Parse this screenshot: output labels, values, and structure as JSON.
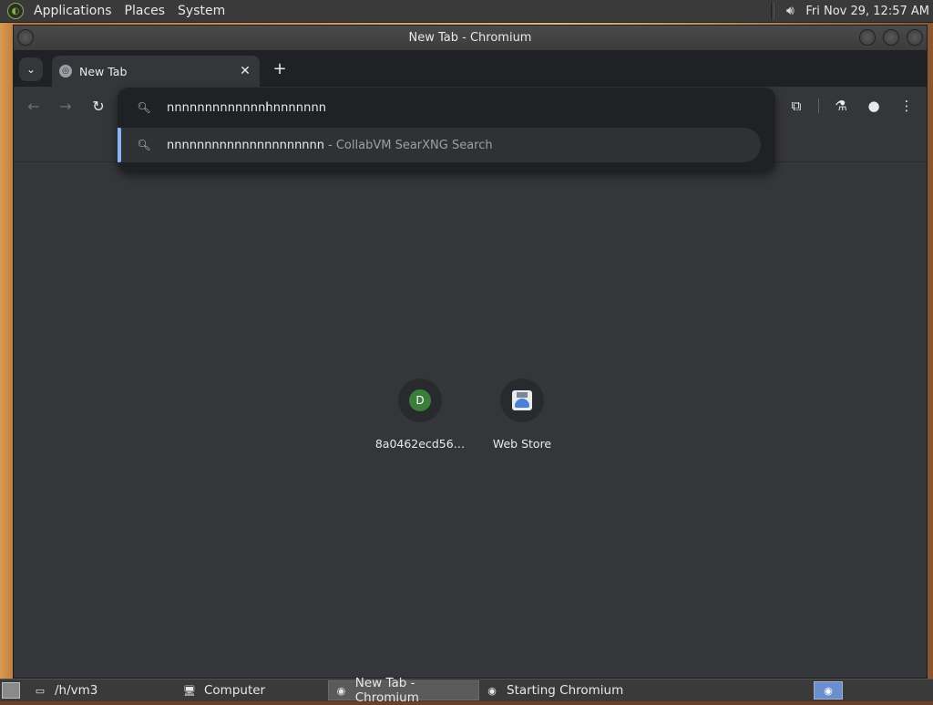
{
  "top_panel": {
    "menus": [
      "Applications",
      "Places",
      "System"
    ],
    "clock": "Fri Nov 29, 12:57 AM",
    "icons": {
      "distro": "distro-logo-icon",
      "volume": "volume-icon"
    }
  },
  "window": {
    "title": "New Tab - Chromium"
  },
  "tabs": {
    "active_tab_title": "New Tab",
    "close_symbol": "✕",
    "new_tab_symbol": "+",
    "tab_search_symbol": "⌄"
  },
  "toolbar": {
    "back_symbol": "←",
    "forward_symbol": "→",
    "reload_symbol": "↻",
    "extensions_symbol": "⧉",
    "labs_symbol": "⚗",
    "profile_symbol": "●",
    "menu_symbol": "⋮"
  },
  "omnibox": {
    "input_value": "nnnnnnnnnnnnnnnnnnnnn",
    "suggestion": {
      "query": "nnnnnnnnnnnnnnnnnnnnn",
      "source": "- CollabVM SearXNG Search"
    }
  },
  "shortcuts": [
    {
      "letter": "D",
      "label": "8a0462ecd56…"
    },
    {
      "label": "Web Store"
    }
  ],
  "taskbar": {
    "items": [
      {
        "label": "/h/vm3",
        "icon": "terminal-icon"
      },
      {
        "label": "Computer",
        "icon": "computer-icon"
      },
      {
        "label": "New Tab - Chromium",
        "icon": "chromium-icon",
        "active": true
      },
      {
        "label": "Starting Chromium",
        "icon": "chromium-icon"
      }
    ]
  },
  "colors": {
    "panel": "#3a3a3a",
    "browser_bg": "#35363a",
    "tabstrip": "#202124",
    "accent": "#8ab4f8"
  }
}
